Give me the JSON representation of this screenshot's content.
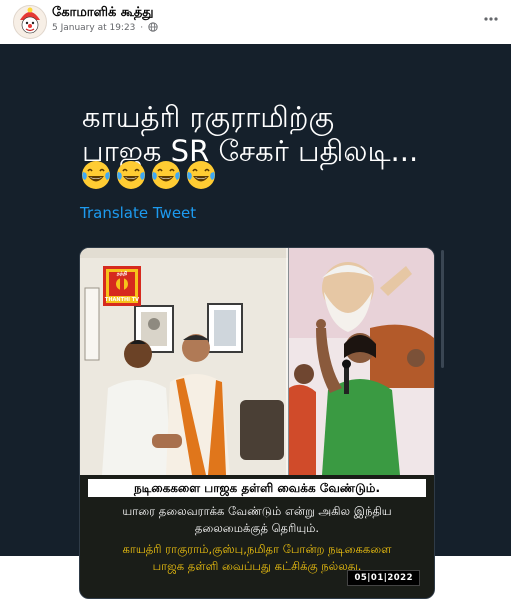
{
  "post": {
    "page_name": "கோமாளிக் கூத்து",
    "timestamp": "5 January at 19:23",
    "separator": "·",
    "icons": {
      "avatar": "clown-avatar",
      "privacy": "globe-icon",
      "more": "more-options-icon"
    }
  },
  "tweet": {
    "text_lines": [
      "காயத்ரி ரகுராமிற்கு",
      "பாஜக SR சேகர் பதிலடி..."
    ],
    "emojis": [
      "😂",
      "😂",
      "😂",
      "😂"
    ],
    "translate_label": "Translate Tweet",
    "colors": {
      "background": "#15202b",
      "text": "#ffffff",
      "link": "#1d9bf0"
    }
  },
  "news_image": {
    "logo_top": "தந்தி",
    "logo_bottom": "THANTHI TV",
    "headline": "நடிகைகளை பாஜக தள்ளி வைக்க வேண்டும்.",
    "caption_white": [
      "யாரை தலைவராக்க வேண்டும் என்று அகில இந்திய",
      "தலைமைக்குத் தெரியும்."
    ],
    "caption_yellow": [
      "காயத்ரி ராகுராம்,குஸ்பு,நமிதா போன்ற நடிகைகளை",
      "பாஜக தள்ளி வைப்பது கட்சிக்கு நல்லது."
    ],
    "date": "05|01|2022",
    "colors": {
      "caption_yellow": "#f1c40f",
      "logo_red": "#d62a1e",
      "logo_yellow": "#f6c21b"
    }
  }
}
